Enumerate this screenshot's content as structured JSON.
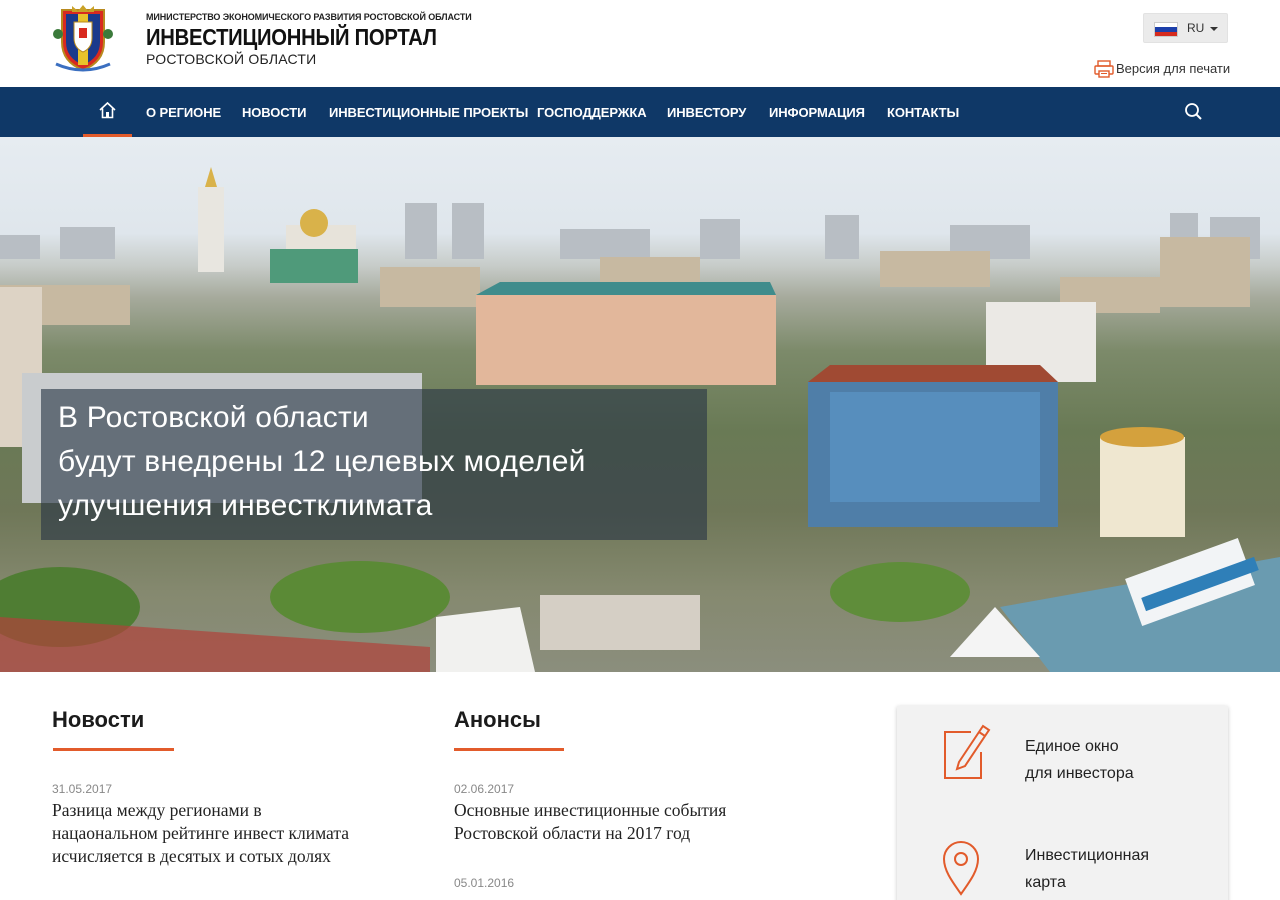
{
  "header": {
    "ministry": "МИНИСТЕРСТВО ЭКОНОМИЧЕСКОГО РАЗВИТИЯ РОСТОВСКОЙ ОБЛАСТИ",
    "title": "ИНВЕСТИЦИОННЫЙ ПОРТАЛ",
    "subtitle": "РОСТОВСКОЙ ОБЛАСТИ",
    "crest_icon": "rostov-oblast-coat-of-arms",
    "language": {
      "label": "RU",
      "flag_icon": "russia-flag-icon"
    },
    "print": {
      "label": "Версия для печати",
      "icon": "printer-icon"
    }
  },
  "nav": {
    "home_icon": "home-icon",
    "items": [
      {
        "label": "О РЕГИОНЕ"
      },
      {
        "label": "НОВОСТИ"
      },
      {
        "label": "ИНВЕСТИЦИОННЫЕ ПРОЕКТЫ"
      },
      {
        "label": "ГОСПОДДЕРЖКА"
      },
      {
        "label": "ИНВЕСТОРУ"
      },
      {
        "label": "ИНФОРМАЦИЯ"
      },
      {
        "label": "КОНТАКТЫ"
      }
    ],
    "search_icon": "search-icon"
  },
  "hero": {
    "lines": [
      "В Ростовской области",
      "будут внедрены 12 целевых моделей",
      "улучшения инвестклимата"
    ]
  },
  "news": {
    "title": "Новости",
    "items": [
      {
        "date": "31.05.2017",
        "lines": [
          "Разница между регионами в",
          "нацаональном рейтинге инвест климата",
          "исчисляется в десятых и сотых долях"
        ]
      }
    ]
  },
  "announcements": {
    "title": "Анонсы",
    "items": [
      {
        "date": "02.06.2017",
        "lines": [
          "Основные инвестиционные события",
          "Ростовской области на 2017 год"
        ]
      },
      {
        "date": "05.01.2016"
      }
    ]
  },
  "sidebar": {
    "items": [
      {
        "lines": [
          "Единое окно",
          "для инвестора"
        ],
        "icon": "document-edit-icon"
      },
      {
        "lines": [
          "Инвестиционная",
          "карта"
        ],
        "icon": "map-pin-icon"
      }
    ]
  },
  "colors": {
    "nav_bg": "#0f3867",
    "accent": "#e25b2b",
    "side_card_bg": "#f2f2f2"
  }
}
